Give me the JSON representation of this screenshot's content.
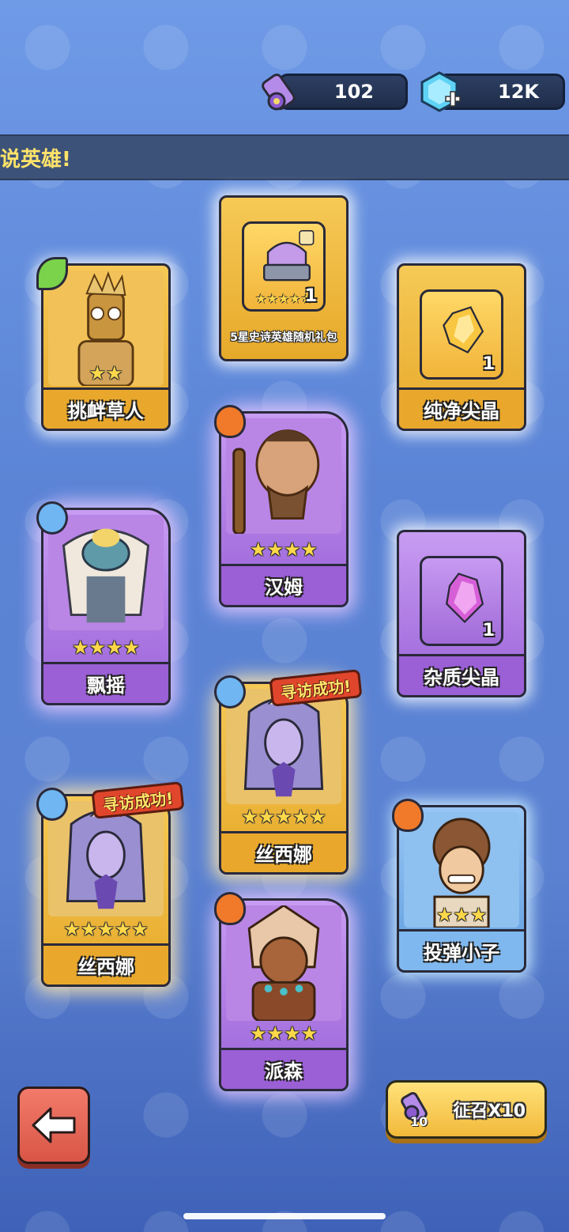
{
  "resources": {
    "scrolls": "102",
    "gems": "12K"
  },
  "banner": {
    "text": "说英雄!"
  },
  "cards": [
    {
      "id": "taunt-scarecrow",
      "name": "挑衅草人",
      "stars": "★★",
      "element": "leaf-icon",
      "rarity": "gold"
    },
    {
      "id": "epic-pack",
      "name": "5星史诗英雄随机礼包",
      "stars": "★★★★★",
      "count": "1",
      "rarity": "gold"
    },
    {
      "id": "pure-spike-crystal",
      "name": "纯净尖晶",
      "count": "1",
      "rarity": "gold"
    },
    {
      "id": "ham",
      "name": "汉姆",
      "stars": "★★★★",
      "element": "fire-icon",
      "rarity": "purple"
    },
    {
      "id": "piaoyao",
      "name": "飘摇",
      "stars": "★★★★",
      "element": "water-icon",
      "rarity": "purple"
    },
    {
      "id": "impure-spike-crystal",
      "name": "杂质尖晶",
      "count": "1",
      "rarity": "purple"
    },
    {
      "id": "sixina-1",
      "name": "丝西娜",
      "stars": "★★★★★",
      "element": "water-icon",
      "ribbon": "寻访成功!",
      "rarity": "gold"
    },
    {
      "id": "sixina-2",
      "name": "丝西娜",
      "stars": "★★★★★",
      "element": "water-icon",
      "ribbon": "寻访成功!",
      "rarity": "gold"
    },
    {
      "id": "catapult-kid",
      "name": "投弹小子",
      "stars": "★★★",
      "element": "fire-icon",
      "rarity": "blue"
    },
    {
      "id": "paisen",
      "name": "派森",
      "stars": "★★★★",
      "element": "fire-icon",
      "rarity": "purple"
    }
  ],
  "buttons": {
    "recruit_label": "征召X10",
    "recruit_count": "10"
  },
  "colors": {
    "gold": "#e9a82c",
    "purple": "#9b5fd6",
    "blue": "#7fb8ee",
    "ribbon": "#e0462c"
  }
}
